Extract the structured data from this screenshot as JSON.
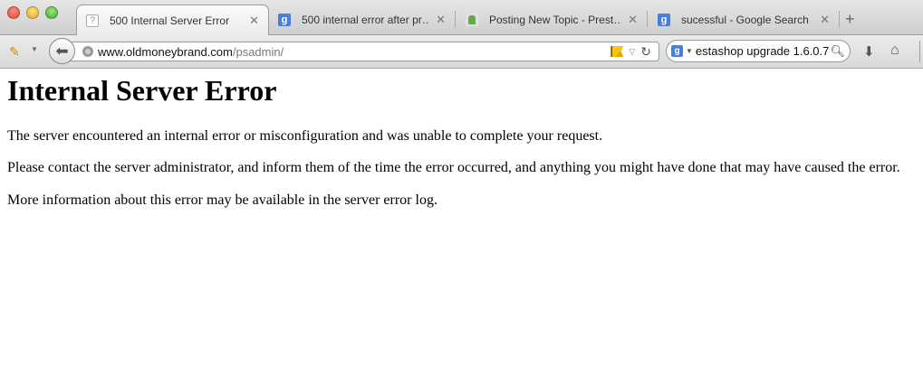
{
  "tabs": [
    {
      "title": "500 Internal Server Error",
      "icon": "question-mark-icon",
      "active": true
    },
    {
      "title": "500 internal error after pr…",
      "icon": "google-icon",
      "active": false
    },
    {
      "title": "Posting New Topic - Prest…",
      "icon": "prestashop-icon",
      "active": false
    },
    {
      "title": "sucessful - Google Search",
      "icon": "google-icon",
      "active": false
    }
  ],
  "tab_close_glyph": "✕",
  "new_tab_glyph": "+",
  "url": {
    "host": "www.oldmoneybrand.com",
    "path": "/psadmin/"
  },
  "search": {
    "engine_glyph": "g",
    "value": "estashop upgrade 1.6.0.7"
  },
  "page": {
    "heading": "Internal Server Error",
    "paragraphs": [
      "The server encountered an internal error or misconfiguration and was unable to complete your request.",
      "Please contact the server administrator, and inform them of the time the error occurred, and anything you might have done that may have caused the error.",
      "More information about this error may be available in the server error log."
    ]
  }
}
